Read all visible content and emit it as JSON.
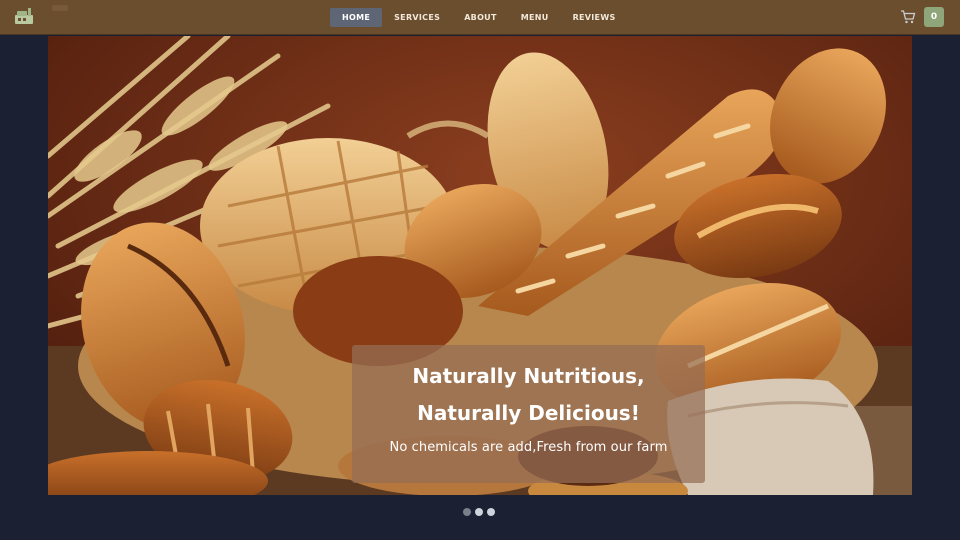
{
  "nav": {
    "links": [
      {
        "label": "HOME",
        "active": true
      },
      {
        "label": "SERVICES",
        "active": false
      },
      {
        "label": "ABOUT",
        "active": false
      },
      {
        "label": "MENU",
        "active": false
      },
      {
        "label": "REVIEWS",
        "active": false
      }
    ],
    "cart_count": "0",
    "icons": [
      "bakery-logo-icon",
      "cart-icon"
    ]
  },
  "hero": {
    "title_line1": "Naturally Nutritious,",
    "title_line2": "Naturally Delicious!",
    "subtitle": "No chemicals are add,Fresh from our farm",
    "image": "bread-basket-photo"
  },
  "carousel": {
    "slide_count": 3,
    "active_index": 1
  },
  "colors": {
    "navbar": "#6b4e2e",
    "page_background": "#1b2133",
    "active_nav": "#5e6676",
    "cart_badge": "#8fa57a"
  }
}
